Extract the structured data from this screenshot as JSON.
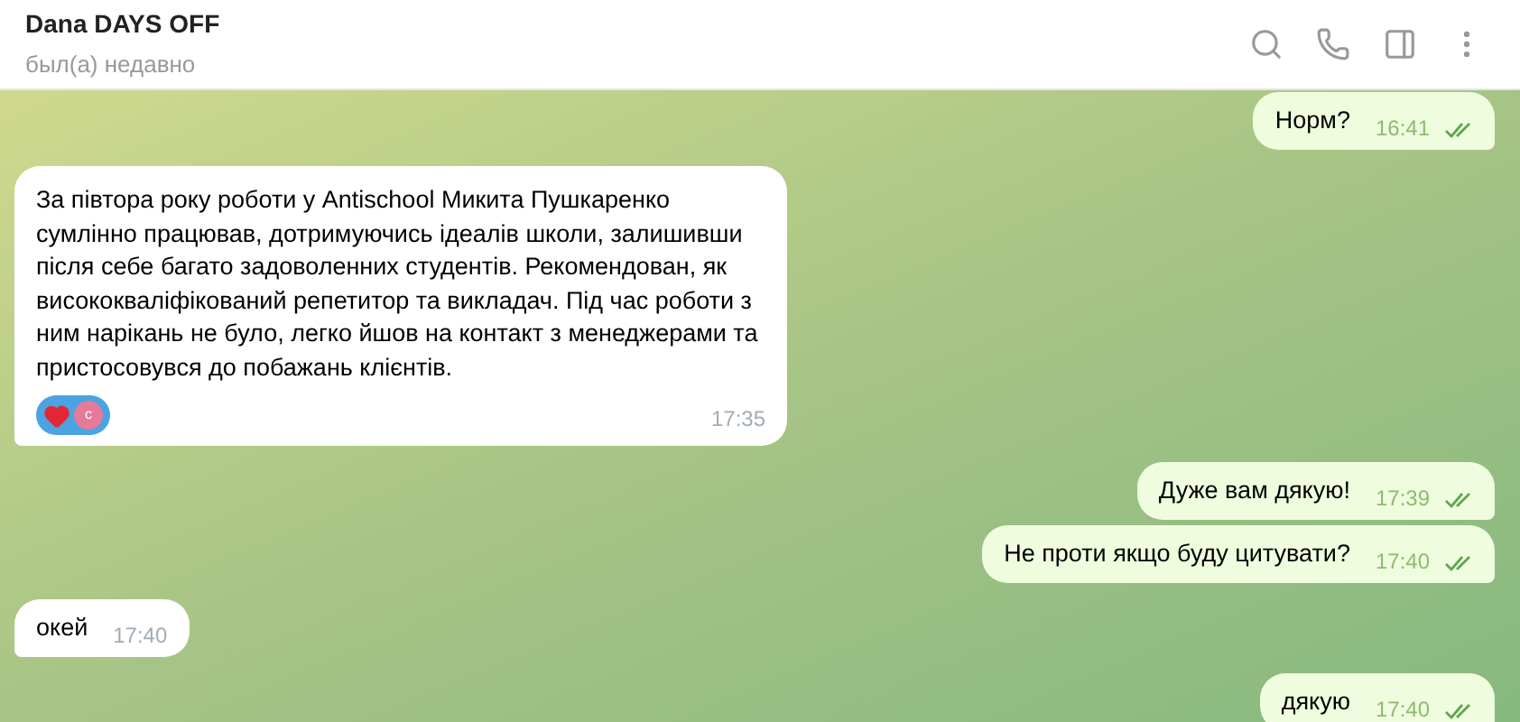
{
  "header": {
    "title": "Dana DAYS OFF",
    "status": "был(а) недавно"
  },
  "messages": [
    {
      "kind": "outgoing",
      "text": "Норм?",
      "time": "16:41",
      "read": true
    },
    {
      "kind": "incoming",
      "text": "За півтора року роботи у Antischool Микита Пушкаренко сумлінно працював, дотримуючись ідеалів школи, залишивши після себе багато задоволенних студентів. Рекомендован, як висококваліфікований репетитор та викладач. Під час роботи з ним нарікань не було, легко йшов на контакт з менеджерами та пристосовувся до побажань клієнтів.",
      "time": "17:35",
      "reaction": {
        "avatar": "с"
      }
    },
    {
      "kind": "outgoing",
      "text": "Дуже вам дякую!",
      "time": "17:39",
      "read": true
    },
    {
      "kind": "outgoing",
      "text": "Не проти якщо буду цитувати?",
      "time": "17:40",
      "read": true
    },
    {
      "kind": "incoming",
      "text": "окей",
      "time": "17:40"
    },
    {
      "kind": "outgoing",
      "text": "дякую",
      "time": "17:40",
      "read": true
    }
  ]
}
